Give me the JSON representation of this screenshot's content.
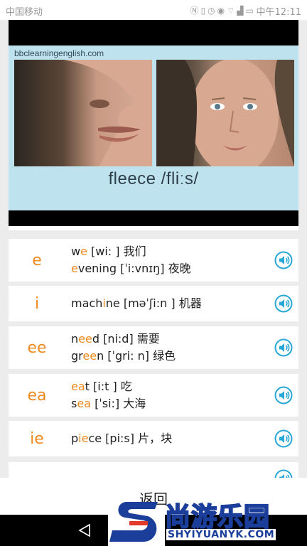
{
  "status_bar": {
    "carrier": "中国移动",
    "icons": [
      "nfc-icon",
      "vibrate-icon",
      "alarm-icon",
      "eye-icon",
      "wifi-icon",
      "signal-icon",
      "battery-icon"
    ],
    "time": "中午12:11"
  },
  "video": {
    "watermark": "bbclearningenglish.com",
    "caption": "fleece  /fliːs/"
  },
  "rows": [
    {
      "spelling": "e",
      "examples": [
        {
          "pre": "w",
          "hl": "e",
          "post": " [wi: ] 我们"
        },
        {
          "pre": "",
          "hl": "e",
          "post": "vening [ˈi:vnɪŋ] 夜晚"
        }
      ]
    },
    {
      "spelling": "i",
      "examples": [
        {
          "pre": "mach",
          "hl": "i",
          "post": "ne [məˈʃi:n ] 机器"
        }
      ]
    },
    {
      "spelling": "ee",
      "examples": [
        {
          "pre": "n",
          "hl": "ee",
          "post": "d [ni:d] 需要"
        },
        {
          "pre": "gr",
          "hl": "ee",
          "post": "n [ˈgri: n] 绿色"
        }
      ]
    },
    {
      "spelling": "ea",
      "examples": [
        {
          "pre": "",
          "hl": "ea",
          "post": "t [i:t ] 吃"
        },
        {
          "pre": "s",
          "hl": "ea",
          "post": " [ˈsi:] 大海"
        }
      ]
    },
    {
      "spelling": "ie",
      "examples": [
        {
          "pre": "p",
          "hl": "ie",
          "post": "ce [pi:s] 片，块"
        }
      ]
    }
  ],
  "back_button": {
    "label": "返回"
  },
  "logo": {
    "cn": "尚游乐园",
    "en": "SHYIYUANYK.COM"
  },
  "colors": {
    "accent": "#ef8a1f",
    "speaker": "#29a8d6"
  }
}
